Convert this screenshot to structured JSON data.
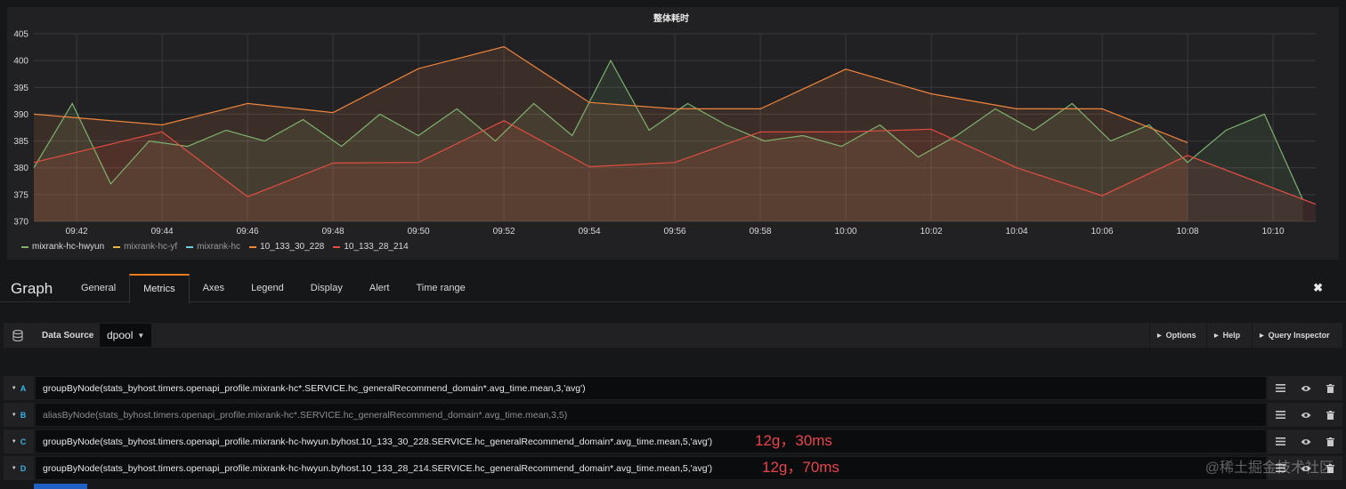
{
  "panel": {
    "title": "整体耗时"
  },
  "chart_data": {
    "type": "line",
    "title": "整体耗时",
    "xlabel": "",
    "ylabel": "",
    "ylim": [
      370,
      405
    ],
    "xlim": [
      9.6833,
      10.1833
    ],
    "grid": true,
    "legend_position": "bottom-left",
    "y_ticks": [
      "405",
      "400",
      "395",
      "390",
      "385",
      "380",
      "375",
      "370"
    ],
    "x_ticks": [
      "09:42",
      "09:44",
      "09:46",
      "09:48",
      "09:50",
      "09:52",
      "09:54",
      "09:56",
      "09:58",
      "10:00",
      "10:02",
      "10:04",
      "10:06",
      "10:08",
      "10:10"
    ],
    "series": [
      {
        "name": "mixrank-hc-hwyun",
        "color": "#7eb26d",
        "x": [
          9.6833,
          9.6983,
          9.7133,
          9.7283,
          9.7433,
          9.7583,
          9.7733,
          9.7883,
          9.8033,
          9.8183,
          9.8333,
          9.8483,
          9.8633,
          9.8783,
          9.8933,
          9.9083,
          9.9233,
          9.9383,
          9.9533,
          9.9683,
          9.9833,
          9.9983,
          10.0133,
          10.0283,
          10.0433,
          10.0583,
          10.0733,
          10.0883,
          10.1033,
          10.1183,
          10.1333,
          10.1483,
          10.1633,
          10.1783
        ],
        "y": [
          380,
          392,
          377,
          385,
          384,
          387,
          385,
          389,
          384,
          390,
          386,
          391,
          385,
          392,
          386,
          400,
          387,
          392,
          388,
          385,
          386,
          384,
          388,
          382,
          386,
          391,
          387,
          392,
          385,
          388,
          381,
          387,
          390,
          374
        ]
      },
      {
        "name": "mixrank-hc-yf",
        "color": "#eab839",
        "x": [],
        "y": []
      },
      {
        "name": "mixrank-hc",
        "color": "#6ed0e0",
        "x": [],
        "y": []
      },
      {
        "name": "10_133_30_228",
        "color": "#ef843c",
        "x": [
          9.6833,
          9.7333,
          9.7667,
          9.8,
          9.8333,
          9.8667,
          9.9,
          9.9333,
          9.9667,
          10.0,
          10.0333,
          10.0667,
          10.1,
          10.1333
        ],
        "y": [
          390,
          388,
          392,
          390.3,
          398.5,
          402.6,
          392.2,
          391,
          391,
          398.4,
          393.8,
          391,
          391,
          384.7
        ]
      },
      {
        "name": "10_133_28_214",
        "color": "#e24d42",
        "x": [
          9.6833,
          9.7333,
          9.7667,
          9.8,
          9.8333,
          9.8667,
          9.9,
          9.9333,
          9.9667,
          10.0,
          10.0333,
          10.0667,
          10.1,
          10.1333,
          10.1833
        ],
        "y": [
          381,
          386.7,
          374.6,
          380.9,
          381,
          388.8,
          380.2,
          381,
          386.7,
          386.7,
          387.2,
          380,
          374.8,
          382.3,
          373.2
        ]
      }
    ]
  },
  "editor": {
    "title": "Graph",
    "tabs": [
      "General",
      "Metrics",
      "Axes",
      "Legend",
      "Display",
      "Alert",
      "Time range"
    ],
    "active_tab": "Metrics",
    "close_label": "✖"
  },
  "datasource": {
    "label": "Data Source",
    "value": "dpool",
    "buttons": [
      "Options",
      "Help",
      "Query Inspector"
    ]
  },
  "queries": [
    {
      "letter": "A",
      "text": "groupByNode(stats_byhost.timers.openapi_profile.mixrank-hc*.SERVICE.hc_generalRecommend_domain*.avg_time.mean,3,'avg')",
      "disabled": false,
      "annotation": ""
    },
    {
      "letter": "B",
      "text": "aliasByNode(stats_byhost.timers.openapi_profile.mixrank-hc*.SERVICE.hc_generalRecommend_domain*.avg_time.mean,3,5)",
      "disabled": true,
      "annotation": ""
    },
    {
      "letter": "C",
      "text": "groupByNode(stats_byhost.timers.openapi_profile.mixrank-hc-hwyun.byhost.10_133_30_228.SERVICE.hc_generalRecommend_domain*.avg_time.mean,5,'avg')",
      "disabled": false,
      "annotation": "12g，30ms"
    },
    {
      "letter": "D",
      "text": "groupByNode(stats_byhost.timers.openapi_profile.mixrank-hc-hwyun.byhost.10_133_28_214.SERVICE.hc_generalRecommend_domain*.avg_time.mean,5,'avg')",
      "disabled": false,
      "annotation": "12g，70ms"
    }
  ],
  "watermark": "@稀土掘金技术社区",
  "icons": [
    "database-icon",
    "hamburger-icon",
    "eye-icon",
    "trash-icon",
    "chevron-down-icon",
    "caret-right-icon",
    "close-icon"
  ]
}
